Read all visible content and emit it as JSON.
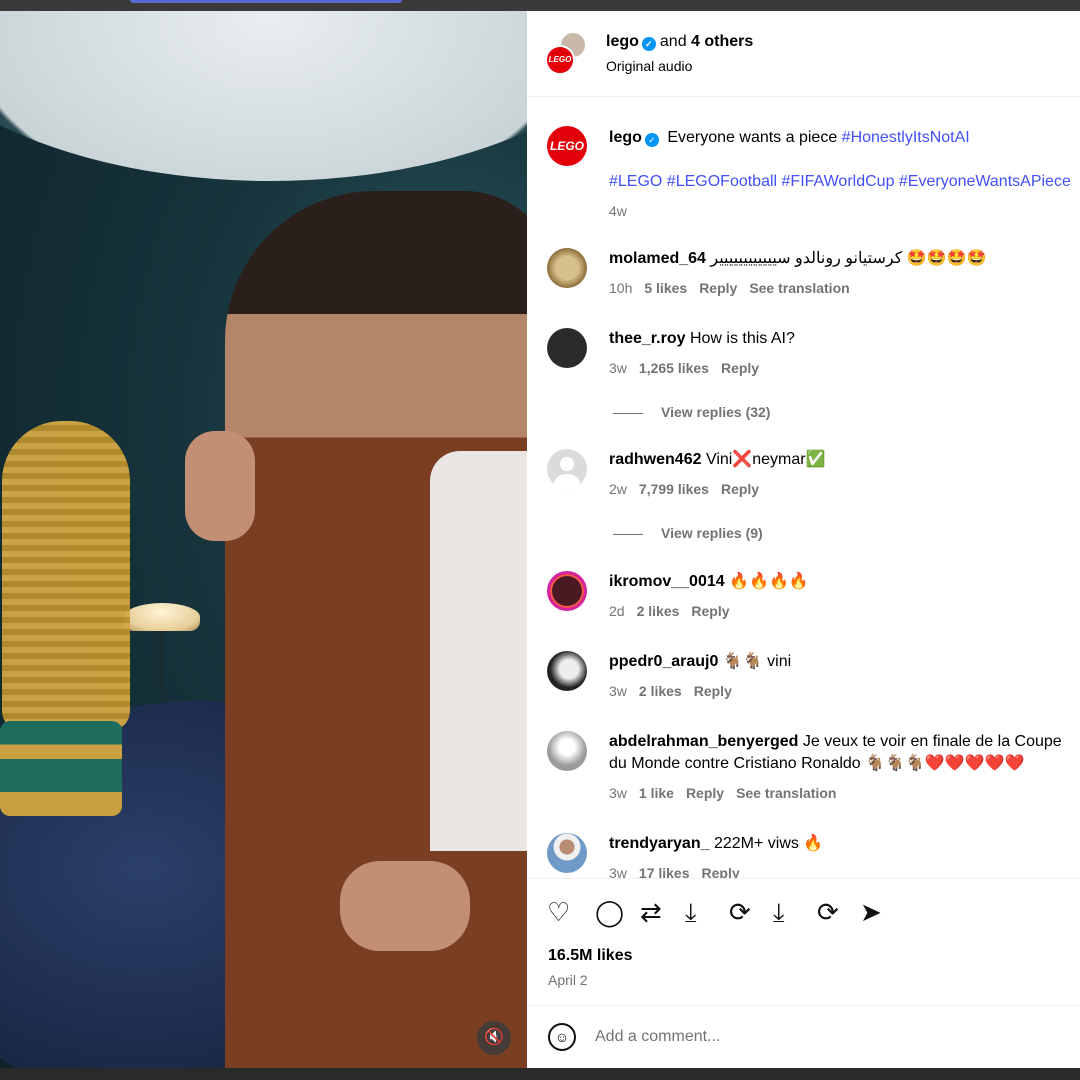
{
  "post": {
    "author": "lego",
    "others": "and",
    "others_count": "4 others",
    "audio": "Original audio",
    "likes": "16.5M likes",
    "date": "April 2"
  },
  "caption": {
    "user": "lego",
    "text": "Everyone wants a piece",
    "tag_inline": "#HonestlyItsNotAI",
    "tags_line": "#LEGO #LEGOFootball #FIFAWorldCup #EveryoneWantsAPiece",
    "time": "4w"
  },
  "comments": [
    {
      "user": "molamed_64",
      "text": "كرستيانو رونالدو سيييييييييييير 🤩🤩🤩🤩",
      "time": "10h",
      "likes": "5 likes",
      "reply": "Reply",
      "translate": "See translation"
    },
    {
      "user": "thee_r.roy",
      "text": "How is this AI?",
      "time": "3w",
      "likes": "1,265 likes",
      "reply": "Reply",
      "view_replies": "View replies (32)"
    },
    {
      "user": "radhwen462",
      "text": "Vini❌neymar✅",
      "time": "2w",
      "likes": "7,799 likes",
      "reply": "Reply",
      "view_replies": "View replies (9)"
    },
    {
      "user": "ikromov__0014",
      "text": "🔥🔥🔥🔥",
      "time": "2d",
      "likes": "2 likes",
      "reply": "Reply"
    },
    {
      "user": "ppedr0_arauj0",
      "text": "🐐🐐 vini",
      "time": "3w",
      "likes": "2 likes",
      "reply": "Reply"
    },
    {
      "user": "abdelrahman_benyerged",
      "text": "Je veux te voir en finale de la Coupe du Monde contre Cristiano Ronaldo 🐐🐐🐐❤️❤️❤️❤️❤️",
      "time": "3w",
      "likes": "1 like",
      "reply": "Reply",
      "translate": "See translation"
    },
    {
      "user": "trendyaryan_",
      "text": "222M+ viws 🔥",
      "time": "3w",
      "likes": "17 likes",
      "reply": "Reply"
    }
  ],
  "add_comment": {
    "placeholder": "Add a comment..."
  },
  "logo_text": "LEGO",
  "icons": [
    "heart-icon",
    "comment-icon",
    "repost-icon",
    "download-icon",
    "sync-icon",
    "download-icon",
    "sync-icon",
    "share-icon",
    "emoji-icon",
    "mute-icon",
    "verified-icon"
  ],
  "colors": {
    "link": "#4150f7",
    "verified": "#0095f6",
    "lego_red": "#e3000b",
    "muted": "#737373"
  }
}
